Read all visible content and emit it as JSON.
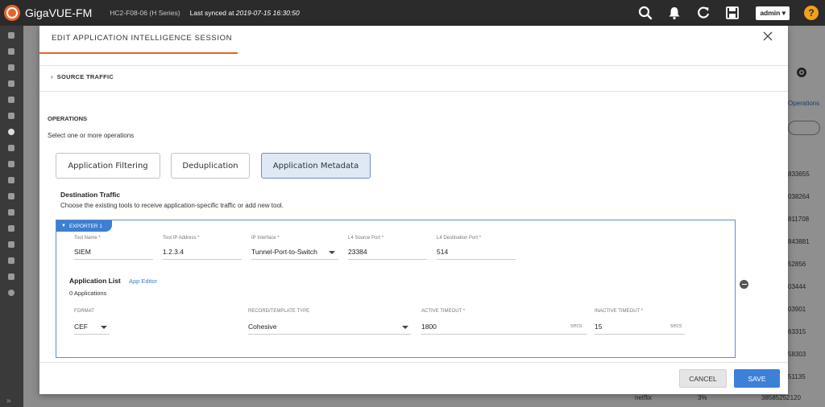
{
  "topbar": {
    "brand": "GigaVUE-FM",
    "device": "HC2-F08-06 (H Series)",
    "sync_prefix": "Last synced at ",
    "sync_time": "2019-07-15 16:30:50",
    "user": "admin",
    "icons": [
      "search-icon",
      "bell-icon",
      "refresh-icon",
      "save-icon",
      "help-icon"
    ]
  },
  "background": {
    "operations_link": "Operations",
    "numbers": [
      "833655",
      "038264",
      "811708",
      "843881",
      "52856",
      "03444",
      "03901",
      "63315",
      "58303",
      "51135"
    ],
    "bottom_row": {
      "name": "netflix",
      "percent": "3%",
      "value": "38585252120"
    }
  },
  "modal": {
    "title": "EDIT APPLICATION INTELLIGENCE SESSION",
    "source_traffic": "SOURCE TRAFFIC",
    "operations": "OPERATIONS",
    "operations_sub": "Select one or more operations",
    "buttons": {
      "filtering": "Application Filtering",
      "dedup": "Deduplication",
      "metadata": "Application Metadata"
    },
    "destination": {
      "title": "Destination Traffic",
      "sub": "Choose the existing tools to receive application-specific traffic or add new tool."
    },
    "exporter": {
      "tab": "EXPORTER 1",
      "tool_name_label": "Tool Name *",
      "tool_name": "SIEM",
      "tool_ip_label": "Tool IP Address *",
      "tool_ip": "1.2.3.4",
      "ip_iface_label": "IP Interface *",
      "ip_iface": "Tunnel-Port-to-Switch",
      "l4_src_label": "L4 Source Port *",
      "l4_src": "23384",
      "l4_dst_label": "L4 Destination Port *",
      "l4_dst": "514",
      "app_list_title": "Application List",
      "app_editor": "App Editor",
      "app_count": "0 Applications",
      "format_label": "FORMAT",
      "format": "CEF",
      "record_label": "RECORD/TEMPLATE TYPE",
      "record": "Cohesive",
      "active_label": "ACTIVE TIMEOUT *",
      "active": "1800",
      "inactive_label": "INACTIVE TIMEOUT *",
      "inactive": "15",
      "unit": "secs"
    },
    "cancel": "CANCEL",
    "save": "SAVE"
  }
}
